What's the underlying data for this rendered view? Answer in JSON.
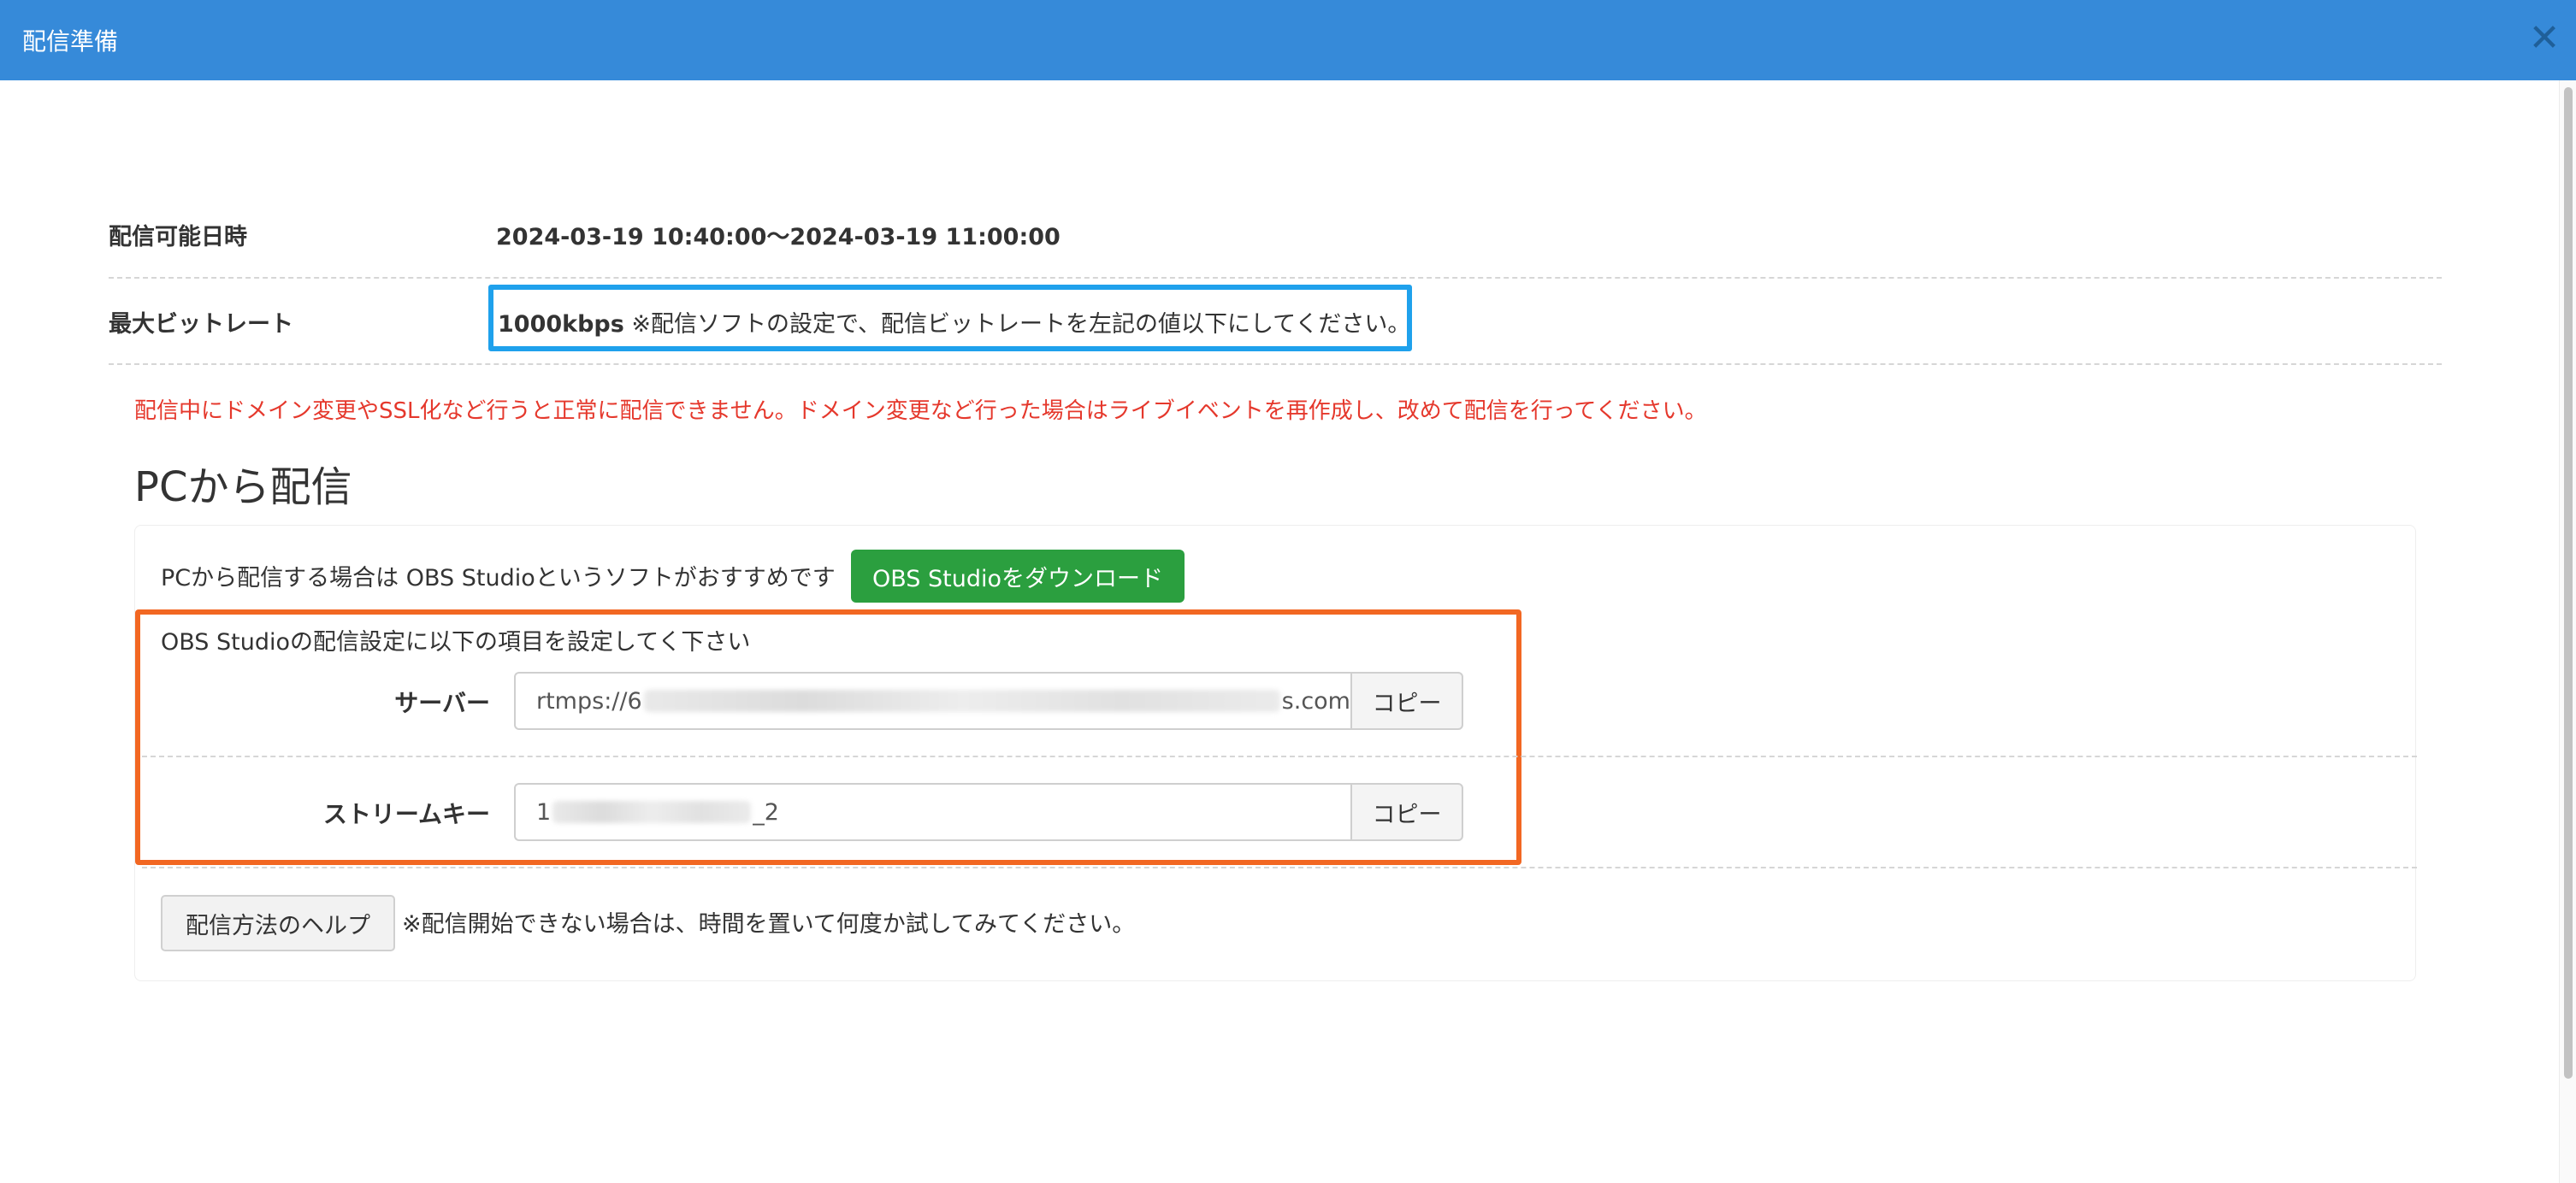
{
  "window": {
    "title": "配信準備"
  },
  "rows": {
    "period": {
      "label": "配信可能日時",
      "value": "2024-03-19 10:40:00〜2024-03-19 11:00:00"
    },
    "bitrate": {
      "label": "最大ビットレート",
      "value_bold": "1000kbps",
      "note": "※配信ソフトの設定で、配信ビットレートを左記の値以下にしてください。"
    }
  },
  "warning": "配信中にドメイン変更やSSL化など行うと正常に配信できません。ドメイン変更など行った場合はライブイベントを再作成し、改めて配信を行ってください。",
  "pc_section": {
    "heading": "PCから配信",
    "recommend_text": "PCから配信する場合は OBS Studioというソフトがおすすめです",
    "download_button": "OBS Studioをダウンロード",
    "settings_intro": "OBS Studioの配信設定に以下の項目を設定してく下さい",
    "server": {
      "label": "サーバー",
      "value_prefix": "rtmps://6",
      "value_suffix": "s.com",
      "copy_label": "コピー"
    },
    "stream_key": {
      "label": "ストリームキー",
      "value_prefix": "1",
      "value_suffix": "_2",
      "copy_label": "コピー"
    },
    "help_button": "配信方法のヘルプ",
    "help_note": "※配信開始できない場合は、時間を置いて何度か試してみてください。"
  },
  "colors": {
    "titlebar": "#368ad9",
    "highlight_blue": "#1fa1ec",
    "highlight_orange": "#f26722",
    "warning_red": "#e5382c",
    "download_green": "#2b9f3f"
  },
  "icons": {
    "close": "close-icon"
  }
}
